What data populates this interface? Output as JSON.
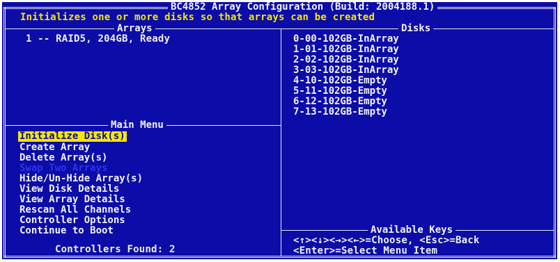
{
  "header": {
    "title": "BC4852 Array Configuration (Build: 2004188.1)",
    "description": "Initializes one or more disks so that arrays can be created"
  },
  "arrays_panel": {
    "title": "Arrays",
    "items": [
      "1 -- RAID5, 204GB, Ready"
    ]
  },
  "disks_panel": {
    "title": "Disks",
    "items": [
      "0-00-102GB-InArray",
      "1-01-102GB-InArray",
      "2-02-102GB-InArray",
      "3-03-102GB-InArray",
      "4-10-102GB-Empty",
      "5-11-102GB-Empty",
      "6-12-102GB-Empty",
      "7-13-102GB-Empty"
    ]
  },
  "main_menu": {
    "title": "Main Menu",
    "items": [
      {
        "label": "Initialize Disk(s)",
        "state": "selected"
      },
      {
        "label": "Create Array",
        "state": "normal"
      },
      {
        "label": "Delete Array(s)",
        "state": "normal"
      },
      {
        "label": "Swap Two Arrays",
        "state": "disabled"
      },
      {
        "label": "Hide/Un-Hide Array(s)",
        "state": "normal"
      },
      {
        "label": "View Disk Details",
        "state": "normal"
      },
      {
        "label": "View Array Details",
        "state": "normal"
      },
      {
        "label": "Rescan All Channels",
        "state": "normal"
      },
      {
        "label": "Controller Options",
        "state": "normal"
      },
      {
        "label": "Continue to Boot",
        "state": "normal"
      }
    ],
    "status": "Controllers Found: 2"
  },
  "keys_panel": {
    "title": "Available Keys",
    "line1": "<↑><↓><→><←>=Choose, <Esc>=Back",
    "line2": "<Enter>=Select Menu Item"
  },
  "colors": {
    "background": "#0c0ca8",
    "text": "#f4f4f4",
    "highlight": "#f6e600",
    "disabled": "#2b36e8"
  }
}
